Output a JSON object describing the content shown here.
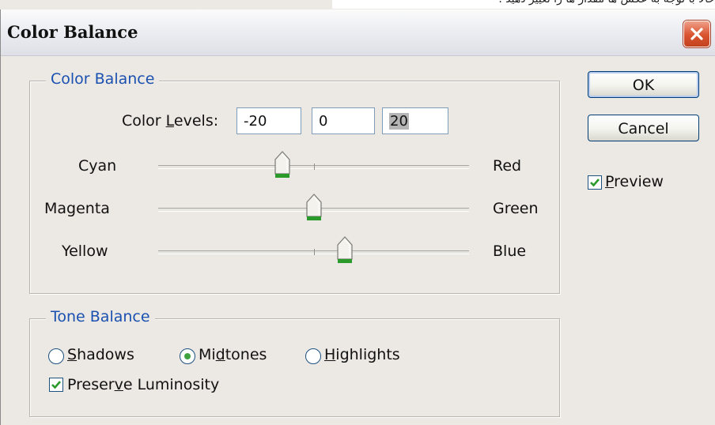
{
  "top_text": "حالا با توجه به عکس ها مقدار ها را تغییر دهید .",
  "window": {
    "title": "Color Balance"
  },
  "color_balance_group": {
    "title": "Color Balance",
    "levels_label_pre": "Color ",
    "levels_label_mnemonic": "L",
    "levels_label_post": "evels:",
    "levels": [
      "-20",
      "0",
      "20"
    ],
    "sliders": [
      {
        "left": "Cyan",
        "right": "Red",
        "value": -20
      },
      {
        "left": "Magenta",
        "right": "Green",
        "value": 0
      },
      {
        "left": "Yellow",
        "right": "Blue",
        "value": 20
      }
    ],
    "slider_range": [
      -100,
      100
    ]
  },
  "tone_balance_group": {
    "title": "Tone Balance",
    "options": [
      {
        "pre": "",
        "mnemonic": "S",
        "post": "hadows",
        "selected": false
      },
      {
        "pre": "Mi",
        "mnemonic": "d",
        "post": "tones",
        "selected": true
      },
      {
        "pre": "",
        "mnemonic": "H",
        "post": "ighlights",
        "selected": false
      }
    ],
    "preserve": {
      "pre": "Preser",
      "mnemonic": "v",
      "post": "e Luminosity",
      "checked": true
    }
  },
  "buttons": {
    "ok": "OK",
    "cancel": "Cancel"
  },
  "preview": {
    "mnemonic": "P",
    "post": "review",
    "checked": true
  },
  "colors": {
    "group_title": "#1a50b0",
    "thumb_green": "#2a9a2a",
    "close_red": "#d9532e"
  },
  "icons": {
    "close": "close-icon",
    "check": "check-icon",
    "thumb": "slider-thumb"
  }
}
